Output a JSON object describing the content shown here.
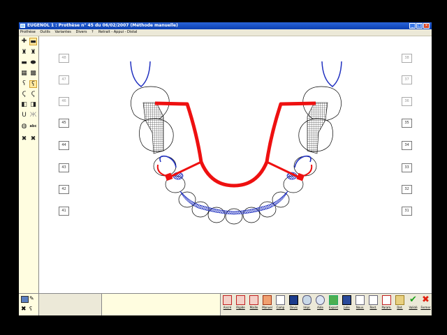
{
  "window": {
    "title": "EUGENOL 1 : Prothèse n° 45 du 06/02/2007 (Méthode manuelle)",
    "controls": [
      "_",
      "□",
      "×"
    ]
  },
  "menu": {
    "items": [
      "Prothèse",
      "Outils",
      "Variantes",
      "Divers",
      "?"
    ],
    "status": "Retrait - Appui - Distal"
  },
  "tool_panel": {
    "tools": [
      "plus",
      "minus",
      "molar",
      "molar-alt",
      "bar",
      "bar-alt",
      "block",
      "block-alt",
      "hook",
      "hook-sel",
      "hook-2",
      "hook-3",
      "clip",
      "clip-2",
      "u-clasp",
      "u-clasp-2",
      "grid-circle",
      "abc",
      "cross",
      "cross-2"
    ],
    "text_tool_label": "abc"
  },
  "teeth_numbers": {
    "right": [
      "48",
      "47",
      "46",
      "45",
      "44",
      "43",
      "42",
      "41"
    ],
    "left": [
      "38",
      "37",
      "36",
      "35",
      "34",
      "33",
      "32",
      "31"
    ]
  },
  "colors": {
    "frame_red": "#ee1010",
    "mesh_blue": "#2030c0",
    "title_blue": "#0b3fb0"
  },
  "toolbar": {
    "buttons": [
      {
        "name": "ancrage",
        "label": "Ancré"
      },
      {
        "name": "rigide",
        "label": "Rigide"
      },
      {
        "name": "maille",
        "label": "Maille"
      },
      {
        "name": "manuel",
        "label": "Manuel"
      },
      {
        "name": "comp",
        "label": "Comp"
      },
      {
        "name": "devis",
        "label": "Devis"
      },
      {
        "name": "impr",
        "label": "Impr."
      },
      {
        "name": "aide",
        "label": "Aide"
      },
      {
        "name": "export",
        "label": "Export"
      },
      {
        "name": "julie",
        "label": "Julie"
      },
      {
        "name": "nouv",
        "label": "Nouv."
      },
      {
        "name": "rest",
        "label": "Rest."
      },
      {
        "name": "param",
        "label": "Param."
      },
      {
        "name": "dot",
        "label": "Dot."
      },
      {
        "name": "valider",
        "label": "Validé"
      },
      {
        "name": "fermer",
        "label": "Fermer"
      }
    ]
  }
}
